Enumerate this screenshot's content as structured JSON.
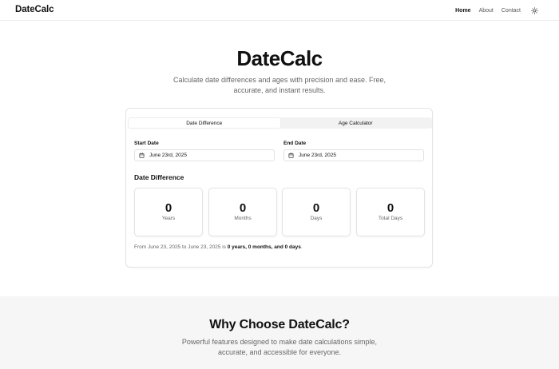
{
  "header": {
    "brand": "DateCalc",
    "nav": [
      {
        "label": "Home",
        "active": true
      },
      {
        "label": "About",
        "active": false
      },
      {
        "label": "Contact",
        "active": false
      }
    ],
    "theme_icon": "sun-icon"
  },
  "hero": {
    "title": "DateCalc",
    "subtitle": "Calculate date differences and ages with precision and ease. Free, accurate, and instant results."
  },
  "calculator": {
    "tabs": [
      {
        "label": "Date Difference",
        "active": true
      },
      {
        "label": "Age Calculator",
        "active": false
      }
    ],
    "start": {
      "label": "Start Date",
      "value": "June 23rd, 2025",
      "icon": "calendar-icon"
    },
    "end": {
      "label": "End Date",
      "value": "June 23rd, 2025",
      "icon": "calendar-icon"
    },
    "result_title": "Date Difference",
    "stats": [
      {
        "value": "0",
        "label": "Years"
      },
      {
        "value": "0",
        "label": "Months"
      },
      {
        "value": "0",
        "label": "Days"
      },
      {
        "value": "0",
        "label": "Total Days"
      }
    ],
    "summary": {
      "prefix": "From June 23, 2025 to June 23, 2025 is ",
      "bold": "0 years, 0 months, and 0 days",
      "suffix": "."
    }
  },
  "features": {
    "title": "Why Choose DateCalc?",
    "subtitle": "Powerful features designed to make date calculations simple, accurate, and accessible for everyone."
  }
}
